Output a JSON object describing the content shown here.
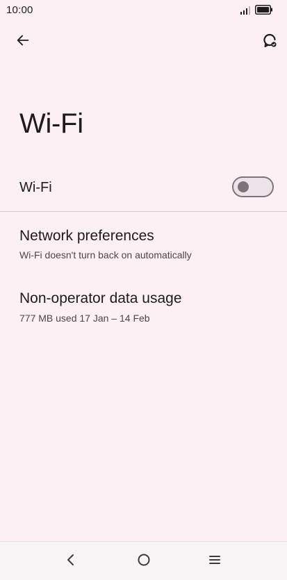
{
  "status_bar": {
    "time": "10:00",
    "icons": [
      "signal-icon",
      "battery-icon"
    ]
  },
  "header": {
    "back_icon": "arrow-left-icon",
    "help_icon": "help-refresh-icon"
  },
  "page": {
    "title": "Wi-Fi"
  },
  "wifi_toggle": {
    "label": "Wi-Fi",
    "state": "off"
  },
  "preferences": [
    {
      "title": "Network preferences",
      "subtitle": "Wi-Fi doesn't turn back on automatically"
    },
    {
      "title": "Non-operator data usage",
      "subtitle": "777 MB used 17 Jan – 14 Feb"
    }
  ],
  "nav_bar": {
    "icons": [
      "back-chevron-icon",
      "home-circle-icon",
      "menu-lines-icon"
    ]
  },
  "colors": {
    "background": "#fcf0f5",
    "text": "#1d1b1e",
    "toggle_outline": "#7b757b"
  }
}
